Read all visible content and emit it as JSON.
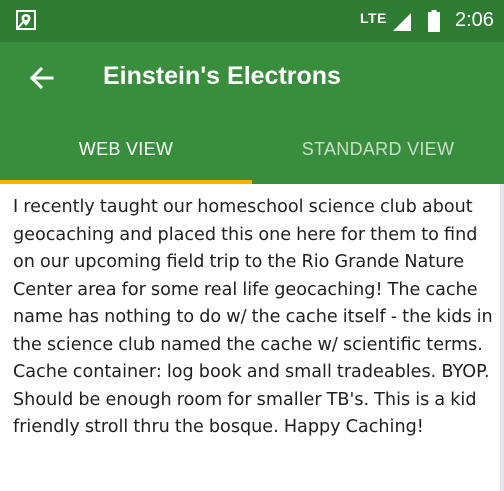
{
  "status_bar": {
    "app_icon": "map-pin-app-icon",
    "network": "LTE",
    "signal_icon": "cell-signal-icon",
    "battery_icon": "battery-icon",
    "time": "2:06"
  },
  "app_bar": {
    "back_icon": "arrow-left-icon",
    "title": "Einstein's Electrons"
  },
  "tabs": [
    {
      "label": "WEB VIEW",
      "selected": true
    },
    {
      "label": "STANDARD VIEW",
      "selected": false
    }
  ],
  "content": {
    "description": "I recently taught our homeschool science club about geocaching and placed this one here for them to find on our upcoming field trip to the Rio Grande Nature Center area for some real life geocaching! The cache name has nothing to do w/ the cache itself - the kids in the science club named the cache w/ scientific terms. Cache container: log book and small tradeables. BYOP. Should be enough room for smaller TB's. This is a kid friendly stroll thru the bosque. Happy Caching!"
  },
  "colors": {
    "status_bar": "#2e7d32",
    "app_bar": "#388e3c",
    "tab_indicator": "#f4b400",
    "body_text": "#1f1f1f"
  }
}
